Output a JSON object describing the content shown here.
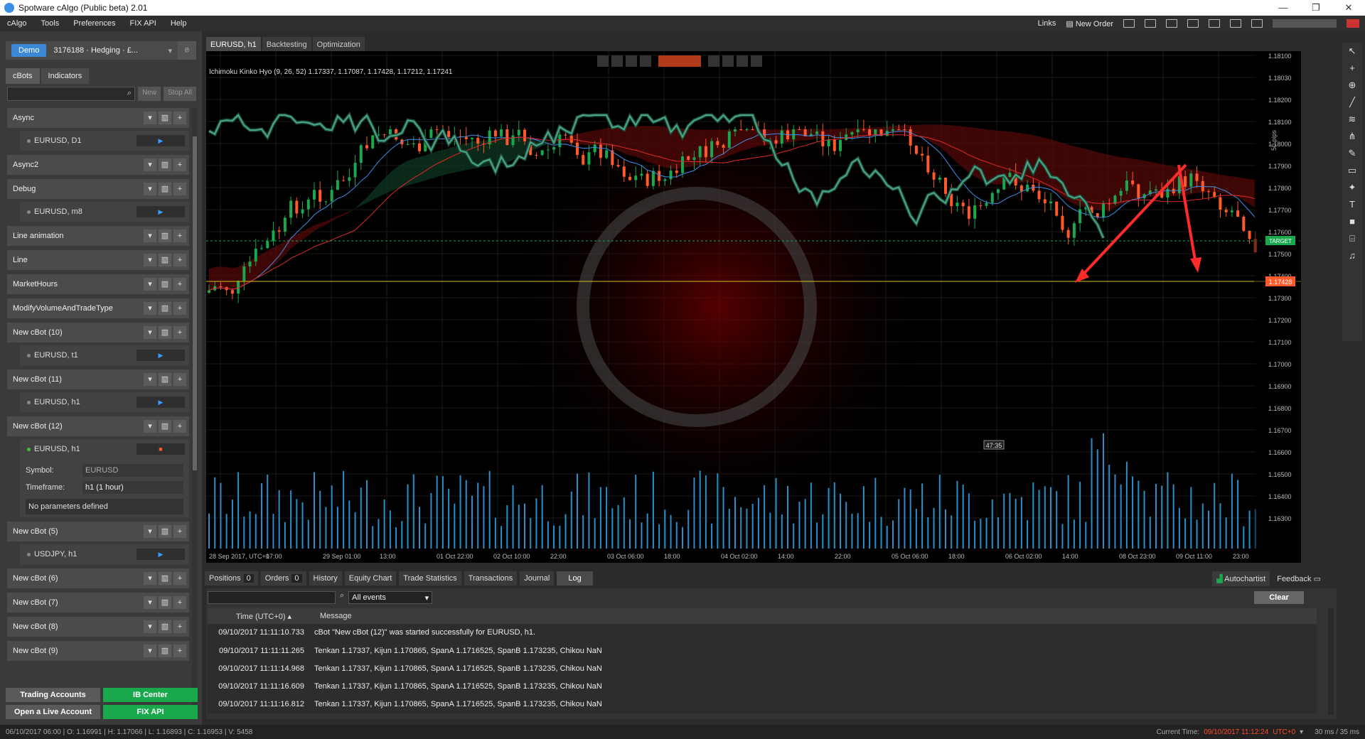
{
  "window": {
    "title": "Spotware cAlgo (Public beta) 2.01",
    "minimize": "—",
    "maximize": "❐",
    "close": "✕"
  },
  "menu": {
    "items": [
      "cAlgo",
      "Tools",
      "Preferences",
      "FIX API",
      "Help"
    ],
    "links": "Links",
    "new_order": "New Order"
  },
  "account": {
    "type": "Demo",
    "label": "3176188 · Hedging · £..."
  },
  "left_tabs": [
    "cBots",
    "Indicators"
  ],
  "left_search": {
    "new": "New",
    "stop_all": "Stop All"
  },
  "bots": [
    {
      "name": "Async",
      "instances": [
        {
          "label": "EURUSD, D1",
          "running": false
        }
      ]
    },
    {
      "name": "Async2",
      "instances": []
    },
    {
      "name": "Debug",
      "instances": [
        {
          "label": "EURUSD, m8",
          "running": false
        }
      ]
    },
    {
      "name": "Line animation",
      "instances": []
    },
    {
      "name": "Line",
      "instances": []
    },
    {
      "name": "MarketHours",
      "instances": []
    },
    {
      "name": "ModifyVolumeAndTradeType",
      "instances": []
    },
    {
      "name": "New cBot (10)",
      "instances": [
        {
          "label": "EURUSD, t1",
          "running": false
        }
      ]
    },
    {
      "name": "New cBot (11)",
      "instances": [
        {
          "label": "EURUSD, h1",
          "running": false
        }
      ]
    },
    {
      "name": "New cBot (12)",
      "instances": [
        {
          "label": "EURUSD, h1",
          "running": true
        }
      ]
    },
    {
      "name": "New cBot (5)",
      "instances": [
        {
          "label": "USDJPY, h1",
          "running": false
        }
      ]
    },
    {
      "name": "New cBot (6)",
      "instances": []
    },
    {
      "name": "New cBot (7)",
      "instances": []
    },
    {
      "name": "New cBot (8)",
      "instances": []
    },
    {
      "name": "New cBot (9)",
      "instances": []
    }
  ],
  "params": {
    "symbol_label": "Symbol:",
    "symbol_value": "EURUSD",
    "timeframe_label": "Timeframe:",
    "timeframe_value": "h1 (1 hour)",
    "none": "No parameters defined"
  },
  "left_buttons": {
    "trading_accounts": "Trading Accounts",
    "ib_center": "IB Center",
    "open_live": "Open a Live Account",
    "fix_api": "FIX API"
  },
  "chart_tabs": [
    "EURUSD, h1",
    "Backtesting",
    "Optimization"
  ],
  "chart": {
    "indicator_label": "Ichimoku Kinko Hyo (9, 26, 52) 1.17337, 1.17087, 1.17428, 1.17212, 1.17241",
    "price_ticks": [
      "1.18100",
      "1.18030",
      "1.18200",
      "1.18100",
      "1.18000",
      "1.17900",
      "1.17800",
      "1.17700",
      "1.17600",
      "1.17500",
      "1.17400",
      "1.17300",
      "1.17200",
      "1.17100",
      "1.17000",
      "1.16900",
      "1.16800",
      "1.16700",
      "1.16600",
      "1.16500",
      "1.16400",
      "1.16300"
    ],
    "time_ticks": [
      "28 Sep 2017, UTC+0",
      "17:00",
      "29 Sep 01:00",
      "13:00",
      "01 Oct 22:00",
      "02 Oct 10:00",
      "22:00",
      "03 Oct 06:00",
      "18:00",
      "04 Oct 02:00",
      "14:00",
      "22:00",
      "05 Oct 06:00",
      "18:00",
      "06 Oct 02:00",
      "14:00",
      "08 Oct 23:00",
      "09 Oct 11:00",
      "23:00"
    ],
    "current_price": "1.17428",
    "target_label": "TARGET",
    "pips_label": "50 pips",
    "countdown": "47:35",
    "colors": {
      "bull": "#1aa84c",
      "bear": "#ff5a28",
      "tenkan": "#3b8eea",
      "kijun": "#e02a2a",
      "chikou": "#4aa88a",
      "price_line": "#d6c12a"
    }
  },
  "bottom_tabs": [
    {
      "label": "Positions",
      "count": "0"
    },
    {
      "label": "Orders",
      "count": "0"
    },
    {
      "label": "History"
    },
    {
      "label": "Equity Chart"
    },
    {
      "label": "Trade Statistics"
    },
    {
      "label": "Transactions"
    },
    {
      "label": "Journal"
    },
    {
      "label": "Log"
    }
  ],
  "bottom_right": {
    "autochartist": "Autochartist",
    "feedback": "Feedback"
  },
  "log": {
    "filter": "All events",
    "clear": "Clear",
    "col_time": "Time (UTC+0)",
    "col_message": "Message",
    "rows": [
      {
        "time": "09/10/2017 11:11:10.733",
        "message": "cBot \"New cBot (12)\" was started successfully for EURUSD, h1."
      },
      {
        "time": "09/10/2017 11:11:11.265",
        "message": "Tenkan 1.17337, Kijun 1.170865, SpanA 1.1716525, SpanB 1.173235, Chikou NaN"
      },
      {
        "time": "09/10/2017 11:11:14.968",
        "message": "Tenkan 1.17337, Kijun 1.170865, SpanA 1.1716525, SpanB 1.173235, Chikou NaN"
      },
      {
        "time": "09/10/2017 11:11:16.609",
        "message": "Tenkan 1.17337, Kijun 1.170865, SpanA 1.1716525, SpanB 1.173235, Chikou NaN"
      },
      {
        "time": "09/10/2017 11:11:16.812",
        "message": "Tenkan 1.17337, Kijun 1.170865, SpanA 1.1716525, SpanB 1.173235, Chikou NaN"
      }
    ]
  },
  "status": {
    "bar_info": "06/10/2017 06:00 | O: 1.16991 | H: 1.17066 | L: 1.16893 | C: 1.16953 | V: 5458",
    "current_time_label": "Current Time:",
    "current_time": "09/10/2017 11:12:24",
    "utc": "UTC+0",
    "latency": "30 ms / 35 ms"
  }
}
